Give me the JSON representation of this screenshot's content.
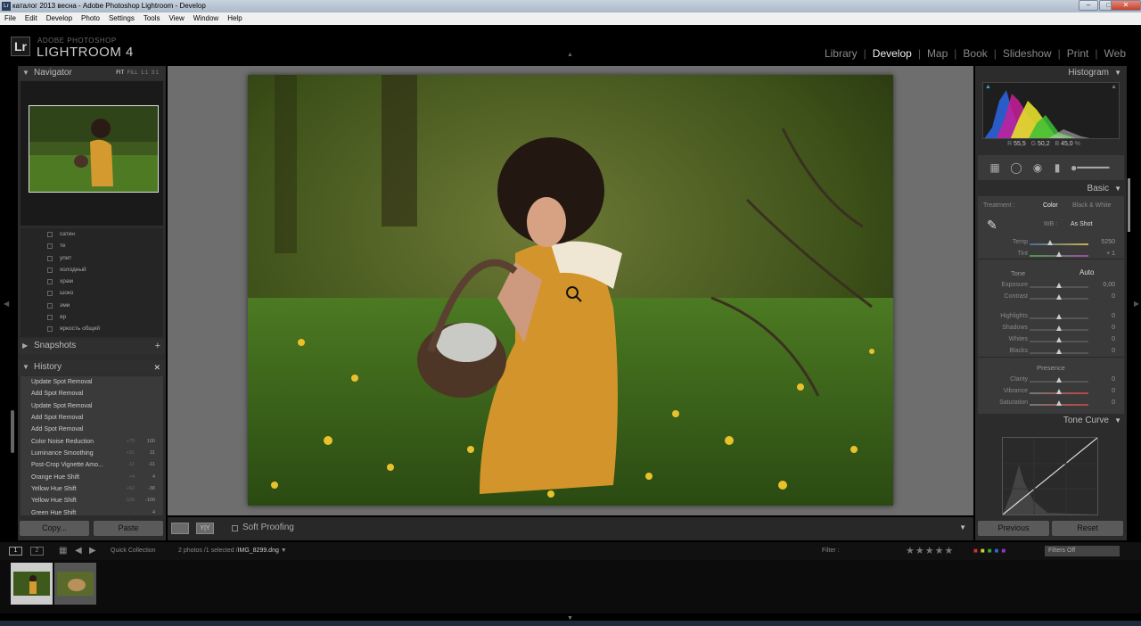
{
  "window": {
    "title": "каталог 2013 весна - Adobe Photoshop Lightroom - Develop",
    "icon": "Lr",
    "min": "–",
    "max": "□",
    "close": "✕"
  },
  "menu": [
    "File",
    "Edit",
    "Develop",
    "Photo",
    "Settings",
    "Tools",
    "View",
    "Window",
    "Help"
  ],
  "header": {
    "logo": "Lr",
    "brand_small": "ADOBE PHOTOSHOP",
    "brand": "LIGHTROOM 4",
    "modules": [
      "Library",
      "Develop",
      "Map",
      "Book",
      "Slideshow",
      "Print",
      "Web"
    ],
    "active_module": "Develop"
  },
  "navigator": {
    "title": "Navigator",
    "options": [
      "FIT",
      "FILL",
      "1:1",
      "3:1"
    ]
  },
  "presets": [
    "сатин",
    "те",
    "упит",
    "холодный",
    "храм",
    "шоко",
    "эми",
    "яр",
    "яркость общий"
  ],
  "snapshots": {
    "title": "Snapshots",
    "add": "+"
  },
  "history": {
    "title": "History",
    "close": "✕",
    "items": [
      {
        "label": "Update Spot Removal",
        "a": "",
        "b": ""
      },
      {
        "label": "Add Spot Removal",
        "a": "",
        "b": ""
      },
      {
        "label": "Update Spot Removal",
        "a": "",
        "b": ""
      },
      {
        "label": "Add Spot Removal",
        "a": "",
        "b": ""
      },
      {
        "label": "Add Spot Removal",
        "a": "",
        "b": ""
      },
      {
        "label": "Color Noise Reduction",
        "a": "+75",
        "b": "100"
      },
      {
        "label": "Luminance Smoothing",
        "a": "+31",
        "b": "31"
      },
      {
        "label": "Post-Crop Vignette Amo...",
        "a": "-11",
        "b": "-11"
      },
      {
        "label": "Orange Hue Shift",
        "a": "+4",
        "b": "4"
      },
      {
        "label": "Yellow Hue Shift",
        "a": "+62",
        "b": "-38"
      },
      {
        "label": "Yellow Hue Shift",
        "a": "-100",
        "b": "-100"
      },
      {
        "label": "Green Hue Shift",
        "a": "-",
        "b": "4"
      }
    ]
  },
  "left_buttons": {
    "copy": "Copy...",
    "paste": "Paste"
  },
  "toolbar": {
    "soft_proofing": "Soft Proofing",
    "yy": "Y|Y"
  },
  "histogram": {
    "title": "Histogram",
    "r_label": "R",
    "r": "55,5",
    "g_label": "G",
    "g": "50,2",
    "b_label": "B",
    "b": "45,0",
    "unit": "%"
  },
  "basic": {
    "title": "Basic",
    "treatment_label": "Treatment :",
    "treatment_color": "Color",
    "treatment_bw": "Black & White",
    "wb_label": "WB :",
    "wb_value": "As Shot",
    "tone_label": "Tone",
    "auto": "Auto",
    "presence_label": "Presence",
    "sliders": [
      {
        "name": "Temp",
        "value": "5250",
        "pos": 0.35,
        "group": "wb"
      },
      {
        "name": "Tint",
        "value": "+ 1",
        "pos": 0.5,
        "group": "wb"
      },
      {
        "name": "Exposure",
        "value": "0,00",
        "pos": 0.5,
        "group": "tone"
      },
      {
        "name": "Contrast",
        "value": "0",
        "pos": 0.5,
        "group": "tone"
      },
      {
        "name": "Highlights",
        "value": "0",
        "pos": 0.5,
        "group": "tone2"
      },
      {
        "name": "Shadows",
        "value": "0",
        "pos": 0.5,
        "group": "tone2"
      },
      {
        "name": "Whites",
        "value": "0",
        "pos": 0.5,
        "group": "tone2"
      },
      {
        "name": "Blacks",
        "value": "0",
        "pos": 0.5,
        "group": "tone2"
      },
      {
        "name": "Clarity",
        "value": "0",
        "pos": 0.5,
        "group": "presence"
      },
      {
        "name": "Vibrance",
        "value": "0",
        "pos": 0.5,
        "group": "presence"
      },
      {
        "name": "Saturation",
        "value": "0",
        "pos": 0.5,
        "group": "presence"
      }
    ]
  },
  "tone_curve": {
    "title": "Tone Curve"
  },
  "right_buttons": {
    "previous": "Previous",
    "reset": "Reset"
  },
  "filmstrip": {
    "page1": "1",
    "page2": "2",
    "source": "Quick Collection",
    "info": "2 photos /1 selected /",
    "filename": "IMG_8299.dng",
    "filter_label": "Filter :",
    "stars": "★★★★★",
    "filters_off": "Filters Off"
  },
  "colors": {
    "panel": "#2c2c2c",
    "accent_active": "#eeeeee"
  }
}
